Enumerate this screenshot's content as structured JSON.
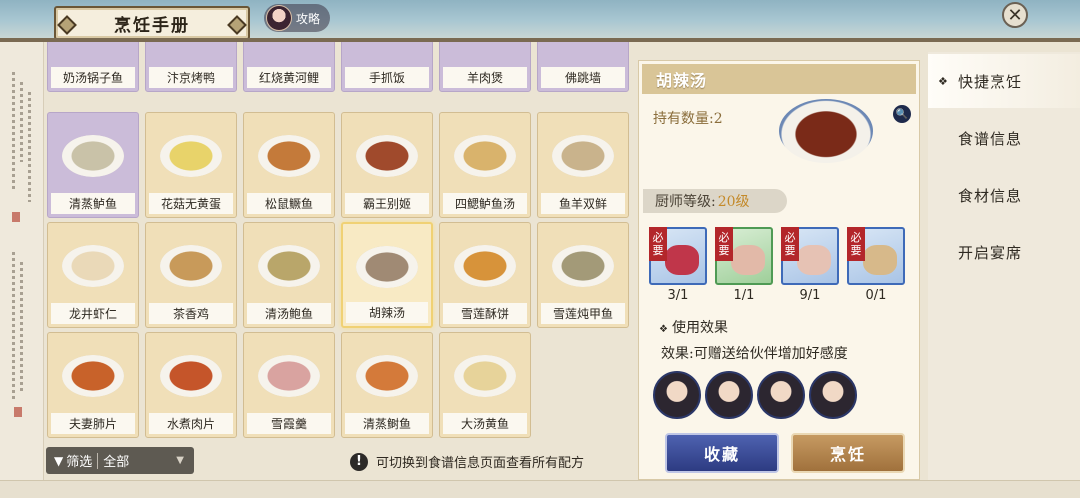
{
  "header": {
    "title": "烹饪手册",
    "guide_label": "攻略",
    "close_symbol": "✕"
  },
  "recipes_top_row": [
    "奶汤锅子鱼",
    "汴京烤鸭",
    "红烧黄河鲤",
    "手抓饭",
    "羊肉煲",
    "佛跳墙"
  ],
  "recipes": [
    {
      "name": "清蒸鲈鱼",
      "tier": "purple",
      "color": "#c9c2a8"
    },
    {
      "name": "花菇无黄蛋",
      "tier": "gold",
      "color": "#e8d36a"
    },
    {
      "name": "松鼠鳜鱼",
      "tier": "gold",
      "color": "#c47a3a"
    },
    {
      "name": "霸王别姬",
      "tier": "gold",
      "color": "#a04a2c"
    },
    {
      "name": "四鳃鲈鱼汤",
      "tier": "gold",
      "color": "#d9b36c"
    },
    {
      "name": "鱼羊双鲜",
      "tier": "gold",
      "color": "#c9b38c"
    },
    {
      "name": "龙井虾仁",
      "tier": "gold",
      "color": "#ead9b8"
    },
    {
      "name": "茶香鸡",
      "tier": "gold",
      "color": "#c89a5a"
    },
    {
      "name": "清汤鲍鱼",
      "tier": "gold",
      "color": "#b9a66a"
    },
    {
      "name": "胡辣汤",
      "tier": "gold",
      "color": "#a08a74",
      "selected": true
    },
    {
      "name": "雪莲酥饼",
      "tier": "gold",
      "color": "#d7933a"
    },
    {
      "name": "雪莲炖甲鱼",
      "tier": "gold",
      "color": "#a39a78"
    },
    {
      "name": "夫妻肺片",
      "tier": "gold",
      "color": "#c8622a"
    },
    {
      "name": "水煮肉片",
      "tier": "gold",
      "color": "#c5552a"
    },
    {
      "name": "雪霞羹",
      "tier": "gold",
      "color": "#d9a3a0"
    },
    {
      "name": "清蒸鲥鱼",
      "tier": "gold",
      "color": "#d47a3a"
    },
    {
      "name": "大汤黄鱼",
      "tier": "gold",
      "color": "#e7d39a"
    }
  ],
  "filter": {
    "label": "筛选",
    "value": "全部"
  },
  "hint": {
    "icon": "!",
    "text": "可切换到食谱信息页面查看所有配方"
  },
  "detail": {
    "dish_name": "胡辣汤",
    "owned": "持有数量:2",
    "chef_level_label": "厨师等级:",
    "chef_level_value": "20级",
    "required_tag": [
      "必",
      "要"
    ],
    "ingredients": [
      {
        "name": "meat",
        "count": "3/1",
        "frame": "blue",
        "color": "#c0364a"
      },
      {
        "name": "flour-sack",
        "count": "1/1",
        "frame": "green",
        "color": "#e2b9a8"
      },
      {
        "name": "flour-sack",
        "count": "9/1",
        "frame": "blue",
        "color": "#e6c2b4"
      },
      {
        "name": "tofu",
        "count": "0/1",
        "frame": "blue",
        "color": "#d7b98a"
      }
    ],
    "effect_title": "使用效果",
    "effect_text": "效果:可赠送给伙伴增加好感度",
    "favorite_label": "收藏",
    "cook_label": "烹饪"
  },
  "tabs": [
    {
      "label": "快捷烹饪",
      "active": true
    },
    {
      "label": "食谱信息",
      "active": false
    },
    {
      "label": "食材信息",
      "active": false
    },
    {
      "label": "开启宴席",
      "active": false
    }
  ]
}
